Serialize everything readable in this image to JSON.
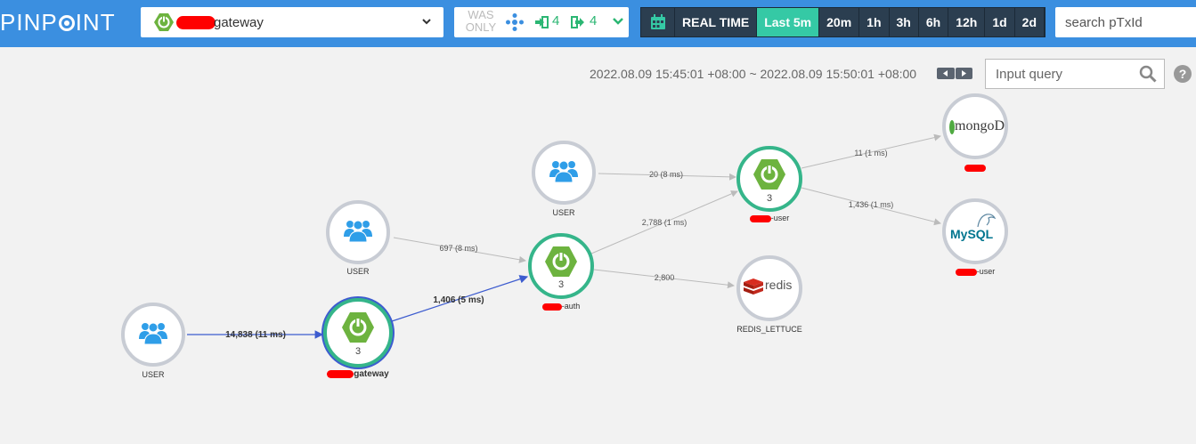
{
  "header": {
    "logo": "PINPOINT",
    "application": {
      "name": "gateway"
    },
    "filter": {
      "was_only": "WAS\nONLY",
      "inbound_count": "4",
      "outbound_count": "4"
    },
    "time_ranges": [
      {
        "label": "REAL TIME",
        "active": false
      },
      {
        "label": "Last 5m",
        "active": true
      },
      {
        "label": "20m",
        "active": false
      },
      {
        "label": "1h",
        "active": false
      },
      {
        "label": "3h",
        "active": false
      },
      {
        "label": "6h",
        "active": false
      },
      {
        "label": "12h",
        "active": false
      },
      {
        "label": "1d",
        "active": false
      },
      {
        "label": "2d",
        "active": false
      }
    ],
    "txid_search": {
      "placeholder": "search pTxId"
    }
  },
  "toolbar": {
    "time_range": "2022.08.09 15:45:01 +08:00 ~ 2022.08.09 15:50:01 +08:00",
    "query": {
      "placeholder": "Input query"
    },
    "help": "?"
  },
  "map": {
    "nodes": [
      {
        "id": "user1",
        "label": "USER"
      },
      {
        "id": "gateway",
        "count": "3",
        "label": "gateway"
      },
      {
        "id": "user2",
        "label": "USER"
      },
      {
        "id": "auth",
        "count": "3",
        "label": "-auth"
      },
      {
        "id": "user3",
        "label": "USER"
      },
      {
        "id": "user-svc",
        "count": "3",
        "label": "-user"
      },
      {
        "id": "redis",
        "logo": "redis",
        "label": "REDIS_LETTUCE"
      },
      {
        "id": "mongo",
        "logo": "mongoDB",
        "label": ""
      },
      {
        "id": "mysql",
        "logo": "MySQL",
        "label": "-user"
      }
    ],
    "edges": [
      {
        "label": "14,838 (11 ms)"
      },
      {
        "label": "1,406 (5 ms)"
      },
      {
        "label": "697 (8 ms)"
      },
      {
        "label": "20 (8 ms)"
      },
      {
        "label": "2,788 (1 ms)"
      },
      {
        "label": "2,800"
      },
      {
        "label": "11 (1 ms)"
      },
      {
        "label": "1,436 (1 ms)"
      }
    ]
  },
  "colors": {
    "header_bg": "#3b8fe0",
    "range_bg": "#2b3e50",
    "range_active": "#35c9a5",
    "node_ok": "#35b58a",
    "node_ring": "#c8ccd4",
    "edge": "#bbbbbb",
    "edge_highlight": "#3d5ccf",
    "spring_green": "#6db33f",
    "user_blue": "#2f9ee8",
    "redact": "#ff0000"
  }
}
